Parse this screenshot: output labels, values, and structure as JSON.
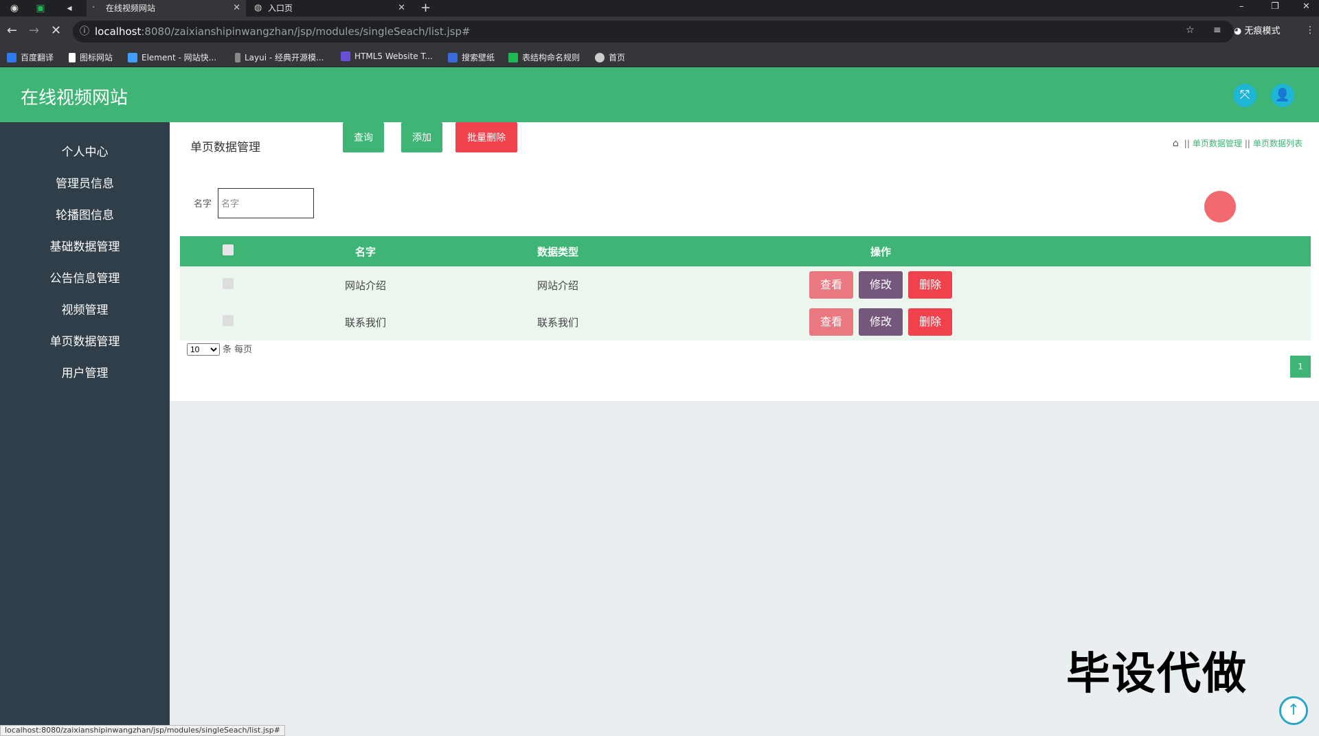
{
  "browser": {
    "tabs": [
      {
        "title": "在线视频网站",
        "active": true
      },
      {
        "title": "入口页",
        "active": false
      }
    ],
    "url_host": "localhost",
    "url_path": ":8080/zaixianshipinwangzhan/jsp/modules/singleSeach/list.jsp#",
    "profile_label": "无痕模式",
    "bookmarks": [
      "百度翻译",
      "图标网站",
      "Element - 网站快...",
      "Layui - 经典开源模...",
      "HTML5 Website T...",
      "搜索壁纸",
      "表结构命名规则",
      "首页"
    ],
    "status_url": "localhost:8080/zaixianshipinwangzhan/jsp/modules/singleSeach/list.jsp#"
  },
  "header": {
    "title": "在线视频网站",
    "colors": {
      "primary": "#3eb575",
      "icon_bg": "#1fb5d5"
    }
  },
  "sidebar": {
    "items": [
      "个人中心",
      "管理员信息",
      "轮播图信息",
      "基础数据管理",
      "公告信息管理",
      "视频管理",
      "单页数据管理",
      "用户管理"
    ]
  },
  "main": {
    "page_title": "单页数据管理",
    "breadcrumb": [
      "单页数据管理",
      "单页数据列表"
    ],
    "search": {
      "label": "名字",
      "placeholder": "名字",
      "value": ""
    },
    "buttons": {
      "query": "查询",
      "add": "添加",
      "batch_delete": "批量删除"
    },
    "table": {
      "headers": [
        "名字",
        "数据类型",
        "操作"
      ],
      "rows": [
        {
          "name": "网站介绍",
          "type": "网站介绍"
        },
        {
          "name": "联系我们",
          "type": "联系我们"
        }
      ],
      "actions": {
        "view": "查看",
        "edit": "修改",
        "delete": "删除"
      }
    },
    "pagination": {
      "page_size": "10",
      "page_size_suffix": "条 每页",
      "current_page": "1"
    }
  },
  "overlay": {
    "watermark": "毕设代做"
  }
}
